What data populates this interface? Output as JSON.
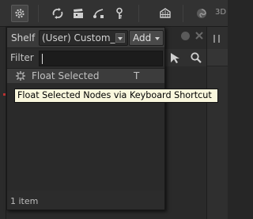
{
  "toolbar": {
    "icons": [
      "gear-icon",
      "recycle-icon",
      "clapper-icon",
      "bezier-icon",
      "key-icon",
      "film-grid-icon",
      "swirl-icon"
    ],
    "right_text": "3D"
  },
  "popup": {
    "shelf_label": "Shelf",
    "shelf_value": "(User) Custom_",
    "add_label": "Add",
    "filter_label": "Filter",
    "filter_value": "",
    "items": [
      {
        "label": "Float Selected",
        "shortcut": "T",
        "icon": "float-icon"
      }
    ],
    "status": "1 item"
  },
  "tooltip": {
    "text": "Float Selected Nodes via Keyboard Shortcut"
  },
  "colors": {
    "tooltip_bg": "#f9f7dd",
    "panel_bg": "#2c2c2c",
    "selected_row": "#3c3c3c"
  }
}
